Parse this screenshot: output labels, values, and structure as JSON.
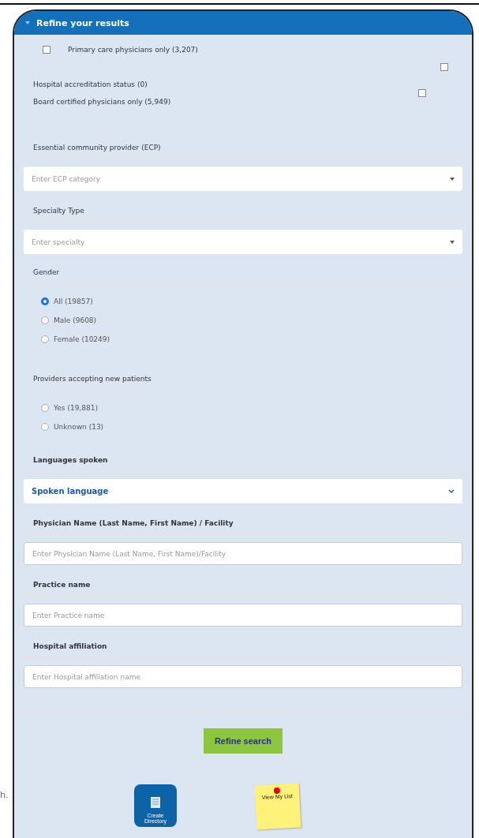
{
  "panel": {
    "title": "Refine your results"
  },
  "checkboxes": [
    {
      "kind": "box-left",
      "label": "Primary care physicians only (3,207)",
      "checked": false
    },
    {
      "kind": "box-right-raised",
      "label": "Hospital accreditation status (0)",
      "checked": false
    },
    {
      "kind": "box-right",
      "label": "Board certified physicians only (5,949)",
      "checked": false
    }
  ],
  "sections": [
    {
      "kind": "select",
      "label": "Essential community provider (ECP)",
      "placeholder": "Enter ECP category"
    },
    {
      "kind": "select",
      "label": "Specialty Type",
      "placeholder": "Enter specialty"
    },
    {
      "kind": "radios",
      "label": "Gender",
      "options": [
        {
          "label": "All (19857)",
          "selected": true
        },
        {
          "label": "Male (9608)",
          "selected": false
        },
        {
          "label": "Female (10249)",
          "selected": false
        }
      ]
    },
    {
      "kind": "radios",
      "label": "Providers accepting new patients",
      "options": [
        {
          "label": "Yes (19,881)",
          "selected": false
        },
        {
          "label": "Unknown (13)",
          "selected": false
        }
      ]
    },
    {
      "kind": "dropdown",
      "label": "Languages spoken",
      "value": "Spoken language"
    },
    {
      "kind": "input",
      "label": "Physician Name (Last Name, First Name) / Facility",
      "placeholder": "Enter Physician Name (Last Name, First Name)/Facility"
    },
    {
      "kind": "input",
      "label": "Practice name",
      "placeholder": "Enter Practice name"
    },
    {
      "kind": "input",
      "label": "Hospital affiliation",
      "placeholder": "Enter Hospital affiliation name"
    }
  ],
  "submit": "Refine search",
  "side_fragment": "h.",
  "shortcuts": [
    {
      "kind": "tile",
      "label": "Create Directory"
    },
    {
      "kind": "note",
      "label": "View My List"
    }
  ]
}
